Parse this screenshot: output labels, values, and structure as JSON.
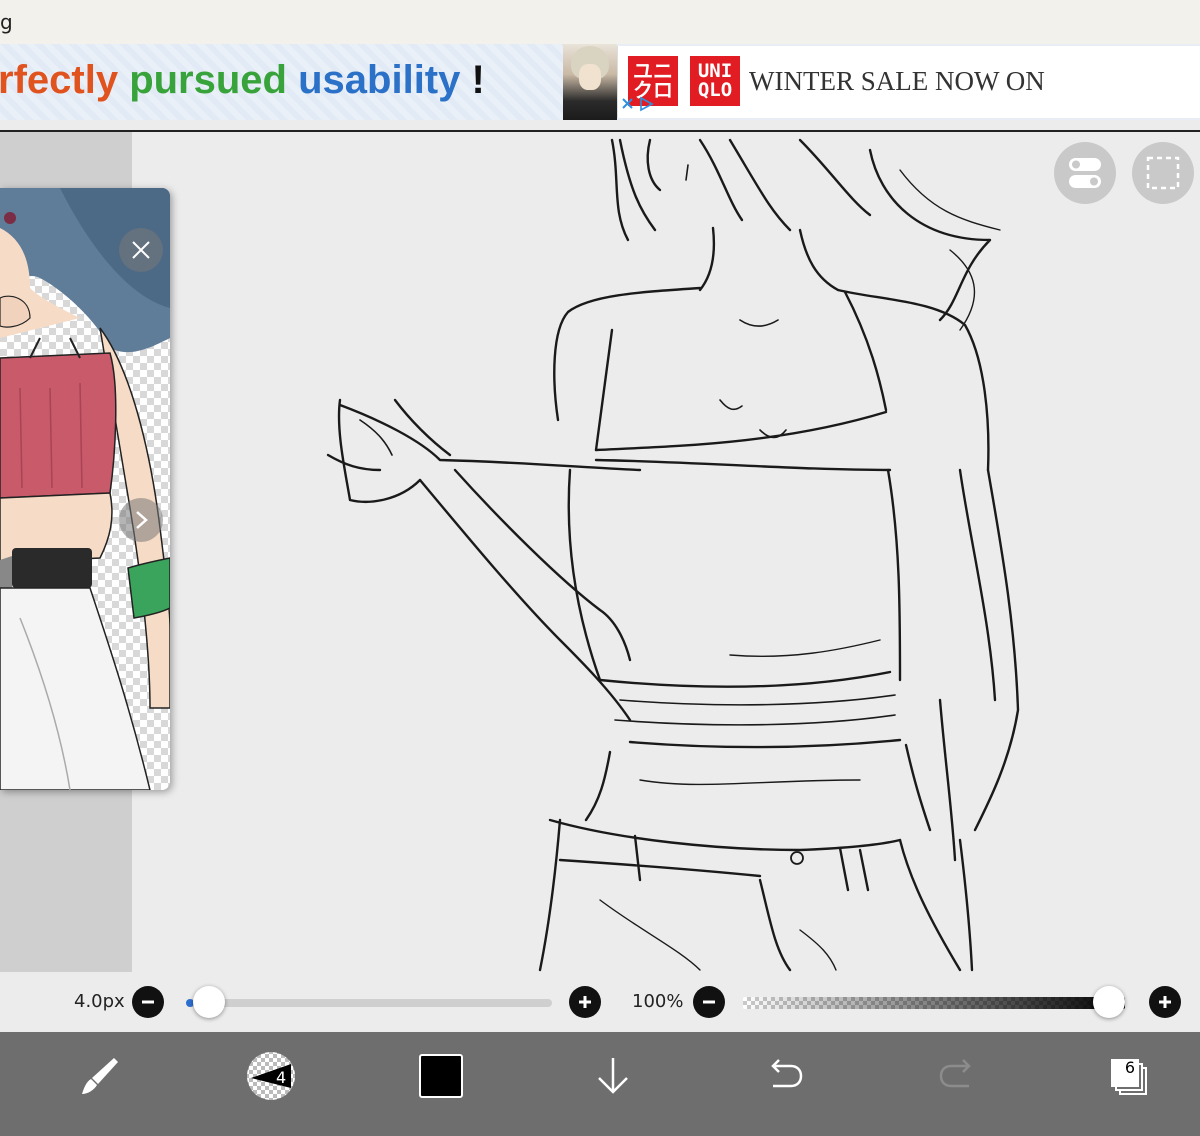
{
  "top_bar": {
    "text": "g"
  },
  "ad": {
    "slogan": [
      "rfectly",
      "pursued",
      "usability",
      "!"
    ],
    "logo_1": "ユニクロ",
    "logo_2_top": "UNI",
    "logo_2_bottom": "QLO",
    "headline": "WINTER SALE NOW ON",
    "close_icon": "ad-close-icon",
    "colors": {
      "brand": "#e21c23",
      "slogan_1": "#e0531e",
      "slogan_2": "#38a33a",
      "slogan_3": "#2b71c8"
    }
  },
  "reference_window": {
    "close_icon": "close-icon",
    "next_icon": "chevron-right-icon"
  },
  "canvas_buttons": {
    "toggle_icon": "toggle-icon",
    "selection_icon": "selection-icon"
  },
  "brush_size": {
    "label": "4.0px",
    "value_fraction": 0.02,
    "accent": "#2d6fd1"
  },
  "opacity": {
    "label": "100%",
    "value_fraction": 1.0
  },
  "toolbar": {
    "brush_icon": "brush-icon",
    "brush_number": "4",
    "color": "#000000",
    "download_icon": "arrow-down-icon",
    "undo_icon": "undo-icon",
    "redo_icon": "redo-icon",
    "layer_count": "6"
  }
}
